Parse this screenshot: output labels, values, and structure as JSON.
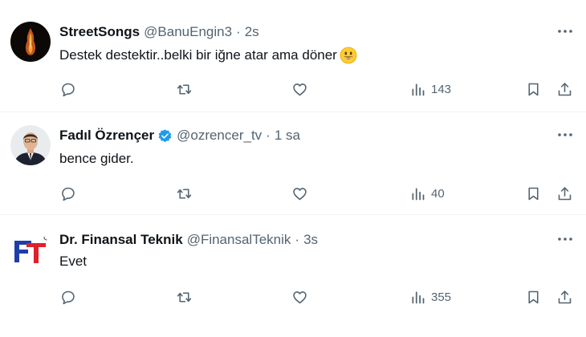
{
  "colors": {
    "text": "#0f1419",
    "secondary": "#536471",
    "verified": "#1d9bf0",
    "divider": "#eff3f4"
  },
  "tweets": [
    {
      "name": "StreetSongs",
      "handle": "@BanuEngin3",
      "separator": "·",
      "time": "2s",
      "text": "Destek destektir..belki bir iğne atar ama döner",
      "emoji": "grinning-face",
      "views": "143",
      "verified": false
    },
    {
      "name": "Fadıl Özrençer",
      "handle": "@ozrencer_tv",
      "separator": "·",
      "time": "1 sa",
      "text": "bence gider.",
      "views": "40",
      "verified": true
    },
    {
      "name": "Dr. Finansal Teknik",
      "handle": "@FinansalTeknik",
      "separator": "·",
      "time": "3s",
      "text": "Evet",
      "views": "355",
      "verified": false,
      "avatar_logo_text": "FT®"
    }
  ]
}
